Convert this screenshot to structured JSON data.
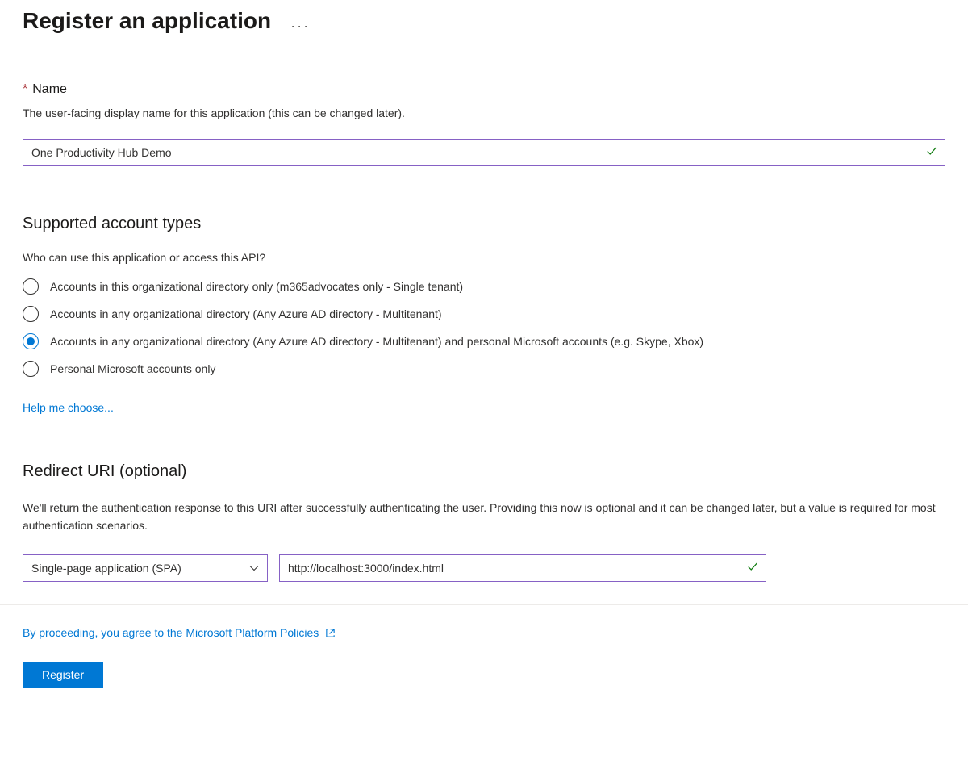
{
  "page_title": "Register an application",
  "name_section": {
    "label": "Name",
    "description": "The user-facing display name for this application (this can be changed later).",
    "value": "One Productivity Hub Demo"
  },
  "account_types": {
    "heading": "Supported account types",
    "description": "Who can use this application or access this API?",
    "options": [
      "Accounts in this organizational directory only (m365advocates only - Single tenant)",
      "Accounts in any organizational directory (Any Azure AD directory - Multitenant)",
      "Accounts in any organizational directory (Any Azure AD directory - Multitenant) and personal Microsoft accounts (e.g. Skype, Xbox)",
      "Personal Microsoft accounts only"
    ],
    "selected_index": 2,
    "help_link": "Help me choose..."
  },
  "redirect_uri": {
    "heading": "Redirect URI (optional)",
    "description": "We'll return the authentication response to this URI after successfully authenticating the user. Providing this now is optional and it can be changed later, but a value is required for most authentication scenarios.",
    "platform_value": "Single-page application (SPA)",
    "uri_value": "http://localhost:3000/index.html"
  },
  "footer": {
    "policy_text": "By proceeding, you agree to the Microsoft Platform Policies",
    "register_label": "Register"
  }
}
